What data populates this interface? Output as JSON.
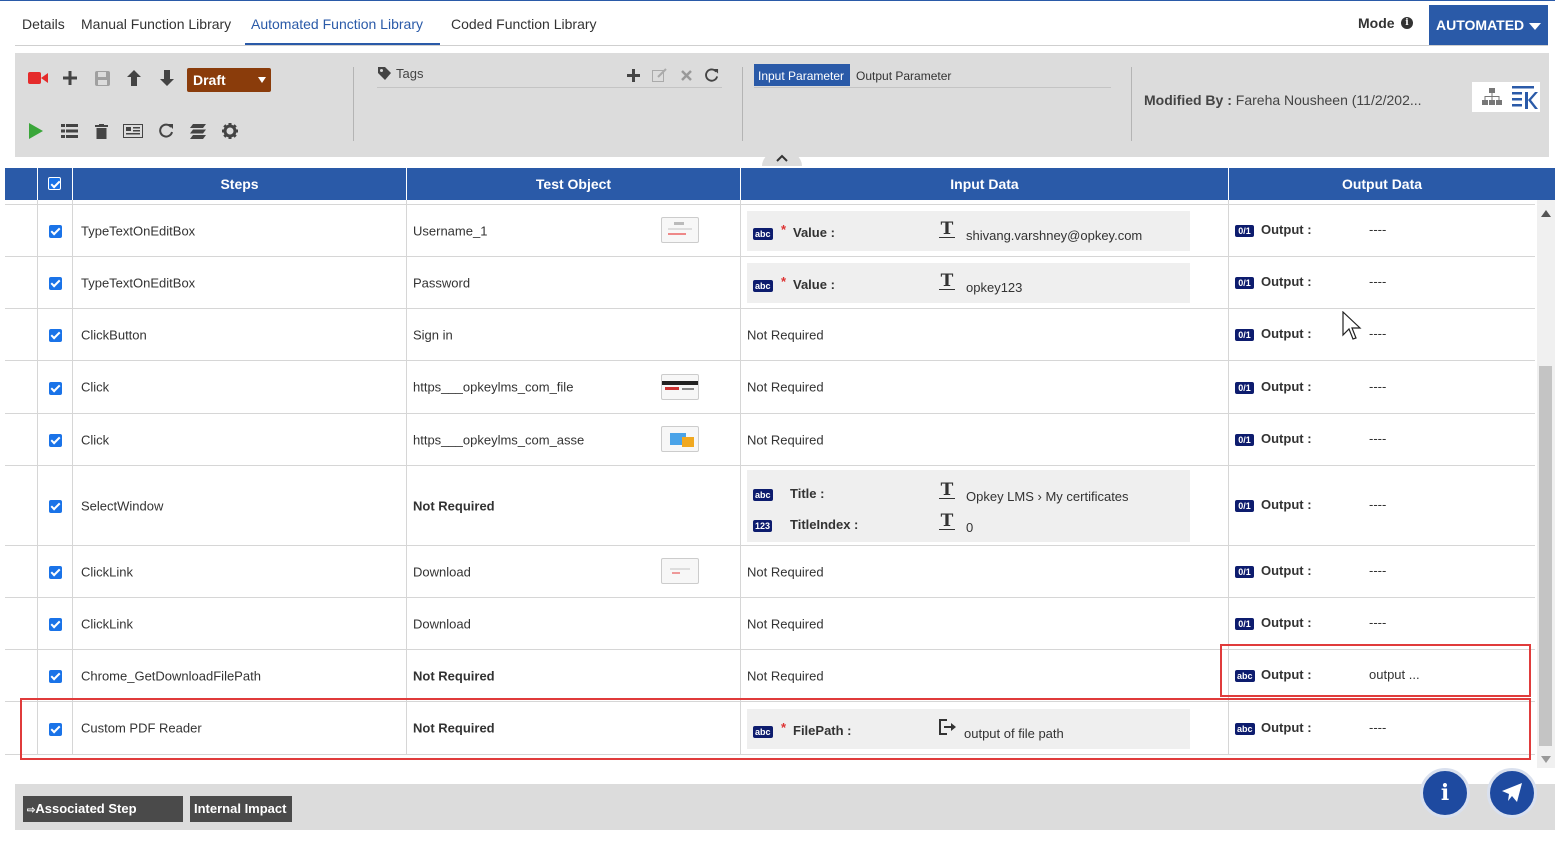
{
  "tabs": [
    {
      "label": "Details"
    },
    {
      "label": "Manual Function Library"
    },
    {
      "label": "Automated Function Library"
    },
    {
      "label": "Coded Function Library"
    }
  ],
  "mode": {
    "label": "Mode",
    "value": "AUTOMATED"
  },
  "toolbar": {
    "status": "Draft",
    "tags_label": "Tags",
    "input_param": "Input Parameter",
    "output_param": "Output Parameter",
    "modified_by_label": "Modified By :",
    "modified_by_value": "Fareha Nousheen (11/2/202..."
  },
  "grid": {
    "headers": {
      "steps": "Steps",
      "test_object": "Test Object",
      "input_data": "Input Data",
      "output_data": "Output Data"
    },
    "rows": [
      {
        "step": "TypeTextOnEditBox",
        "object": "Username_1",
        "input": {
          "type": "param",
          "params": [
            {
              "badge": "abc",
              "label": "Value :",
              "required": true,
              "value": "shivang.varshney@opkey.com"
            }
          ]
        },
        "output_badge": "0/1",
        "output_label": "Output :",
        "output_value": "----"
      },
      {
        "step": "TypeTextOnEditBox",
        "object": "Password",
        "input": {
          "type": "param",
          "params": [
            {
              "badge": "abc",
              "label": "Value :",
              "required": true,
              "value": "opkey123"
            }
          ]
        },
        "output_badge": "0/1",
        "output_label": "Output :",
        "output_value": "----"
      },
      {
        "step": "ClickButton",
        "object": "Sign in",
        "input": {
          "type": "text",
          "text": "Not Required"
        },
        "output_badge": "0/1",
        "output_label": "Output :",
        "output_value": "----"
      },
      {
        "step": "Click",
        "object": "https___opkeylms_com_file",
        "input": {
          "type": "text",
          "text": "Not Required"
        },
        "output_badge": "0/1",
        "output_label": "Output :",
        "output_value": "----"
      },
      {
        "step": "Click",
        "object": "https___opkeylms_com_asse",
        "input": {
          "type": "text",
          "text": "Not Required"
        },
        "output_badge": "0/1",
        "output_label": "Output :",
        "output_value": "----"
      },
      {
        "step": "SelectWindow",
        "object": "Not Required",
        "input": {
          "type": "param",
          "params": [
            {
              "badge": "abc",
              "label": "Title :",
              "required": false,
              "value": "Opkey LMS › My certificates"
            },
            {
              "badge": "123",
              "label": "TitleIndex :",
              "required": false,
              "value": "0"
            }
          ]
        },
        "output_badge": "0/1",
        "output_label": "Output :",
        "output_value": "----"
      },
      {
        "step": "ClickLink",
        "object": "Download",
        "input": {
          "type": "text",
          "text": "Not Required"
        },
        "output_badge": "0/1",
        "output_label": "Output :",
        "output_value": "----"
      },
      {
        "step": "ClickLink",
        "object": "Download",
        "input": {
          "type": "text",
          "text": "Not Required"
        },
        "output_badge": "0/1",
        "output_label": "Output :",
        "output_value": "----"
      },
      {
        "step": "Chrome_GetDownloadFilePath",
        "object": "Not Required",
        "input": {
          "type": "text",
          "text": "Not Required"
        },
        "output_badge": "abc",
        "output_label": "Output :",
        "output_value": "output ..."
      },
      {
        "step": "Custom PDF Reader",
        "object": "Not Required",
        "input": {
          "type": "param",
          "params": [
            {
              "badge": "abc",
              "label": "FilePath :",
              "required": true,
              "value": "output of file path",
              "icon": "output-ref"
            }
          ]
        },
        "output_badge": "abc",
        "output_label": "Output :",
        "output_value": "----"
      }
    ]
  },
  "bottom": {
    "associated_output": "Associated Step Output",
    "internal_impact": "Internal Impact"
  },
  "colors": {
    "primary": "#2a5aa8",
    "draft": "#8a3c0b",
    "highlight": "#e03b3b",
    "record": "#e52b2b",
    "run": "#3aa63a"
  }
}
